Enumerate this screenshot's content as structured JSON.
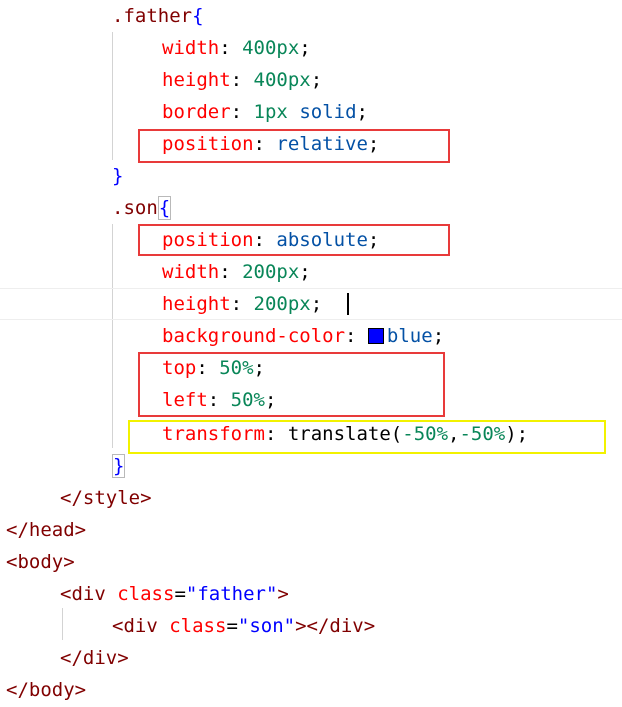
{
  "code": {
    "father_selector": ".father",
    "open_brace": "{",
    "close_brace": "}",
    "father_width_prop": "width",
    "father_width_val": "400px",
    "father_height_prop": "height",
    "father_height_val": "400px",
    "father_border_prop": "border",
    "father_border_num": "1px",
    "father_border_val": "solid",
    "father_position_prop": "position",
    "father_position_val": "relative",
    "son_selector": ".son",
    "son_position_prop": "position",
    "son_position_val": "absolute",
    "son_width_prop": "width",
    "son_width_val": "200px",
    "son_height_prop": "height",
    "son_height_val": "200px",
    "son_bg_prop": "background-color",
    "son_bg_val": "blue",
    "son_top_prop": "top",
    "son_top_val": "50%",
    "son_left_prop": "left",
    "son_left_val": "50%",
    "son_transform_prop": "transform",
    "son_transform_fn": "translate",
    "son_transform_arg1": "-50%",
    "son_transform_arg2": "-50%",
    "style_close": "/style",
    "head_close": "/head",
    "body_open": "body",
    "div_tag": "div",
    "div_close": "/div",
    "class_attr": "class",
    "father_class": "\"father\"",
    "son_class": "\"son\"",
    "body_close": "/body"
  },
  "colors": {
    "swatch": "#0000ff",
    "highlight_red": "#e83a3a",
    "highlight_yellow": "#f2f200"
  }
}
